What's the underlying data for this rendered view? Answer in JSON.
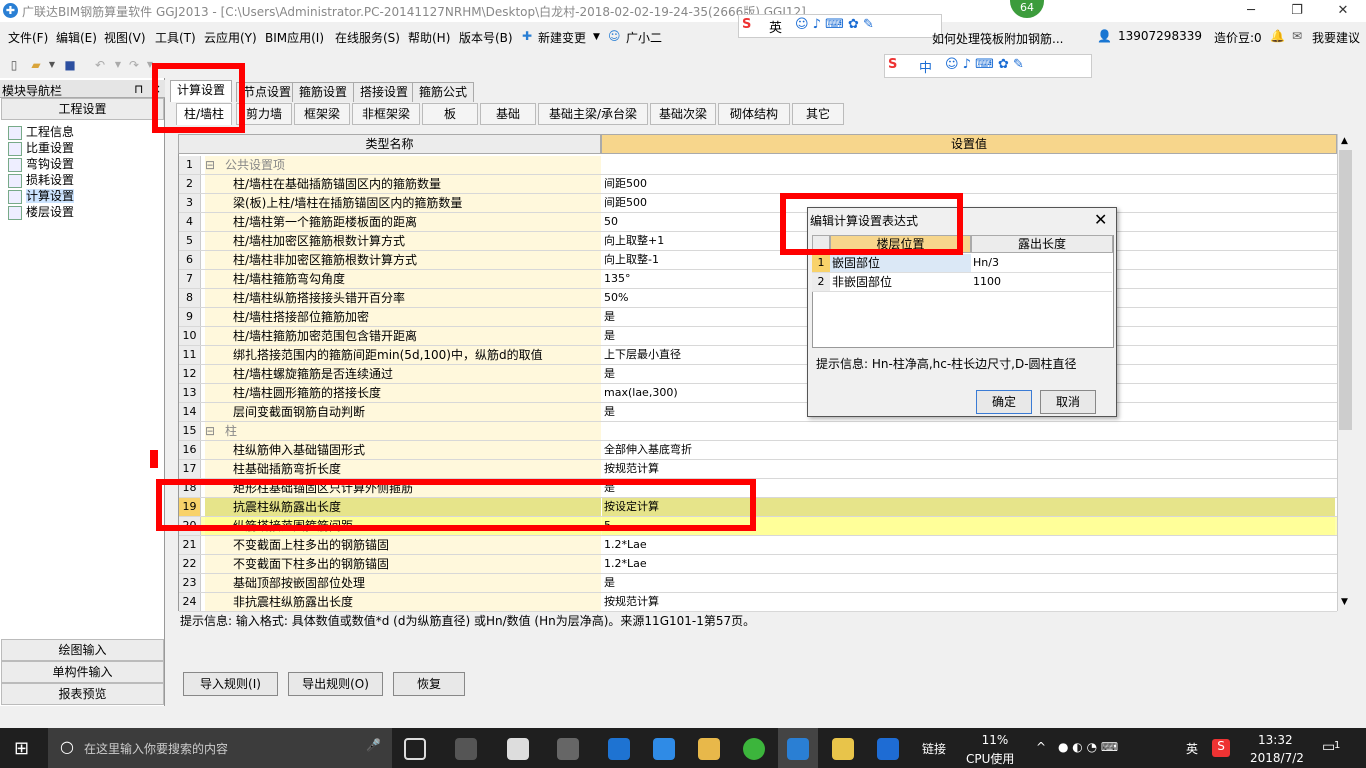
{
  "window": {
    "title": "广联达BIM钢筋算量软件 GGJ2013 - [C:\\Users\\Administrator.PC-20141127NRHM\\Desktop\\白龙村-2018-02-02-19-24-35(2666版).GGJ12]",
    "badge": "64"
  },
  "menu": [
    "文件(F)",
    "编辑(E)",
    "视图(V)",
    "工具(T)",
    "云应用(Y)",
    "BIM应用(I)",
    "在线服务(S)",
    "帮助(H)",
    "版本号(B)",
    "新建变更",
    "广小二"
  ],
  "topright": {
    "promo": "如何处理筏板附加钢筋...",
    "phone": "13907298339",
    "cost": "造价豆:0",
    "feedback": "我要建议"
  },
  "ime": {
    "lang1": "英",
    "lang2": "中"
  },
  "nav": {
    "header": "模块导航栏",
    "section": "工程设置",
    "items": [
      "工程信息",
      "比重设置",
      "弯钩设置",
      "损耗设置",
      "计算设置",
      "楼层设置"
    ],
    "bottom": [
      "绘图输入",
      "单构件输入",
      "报表预览"
    ]
  },
  "tabs1": [
    "计算设置",
    "节点设置",
    "箍筋设置",
    "搭接设置",
    "箍筋公式"
  ],
  "tabs2": [
    "柱/墙柱",
    "剪力墙",
    "框架梁",
    "非框架梁",
    "板",
    "基础",
    "基础主梁/承台梁",
    "基础次梁",
    "砌体结构",
    "其它"
  ],
  "grid": {
    "col1": "类型名称",
    "col2": "设置值",
    "rows": [
      {
        "n": "1",
        "name": "公共设置项",
        "val": "",
        "grp": true
      },
      {
        "n": "2",
        "name": "柱/墙柱在基础插筋锚固区内的箍筋数量",
        "val": "间距500"
      },
      {
        "n": "3",
        "name": "梁(板)上柱/墙柱在插筋锚固区内的箍筋数量",
        "val": "间距500"
      },
      {
        "n": "4",
        "name": "柱/墙柱第一个箍筋距楼板面的距离",
        "val": "50"
      },
      {
        "n": "5",
        "name": "柱/墙柱加密区箍筋根数计算方式",
        "val": "向上取整+1"
      },
      {
        "n": "6",
        "name": "柱/墙柱非加密区箍筋根数计算方式",
        "val": "向上取整-1"
      },
      {
        "n": "7",
        "name": "柱/墙柱箍筋弯勾角度",
        "val": "135°"
      },
      {
        "n": "8",
        "name": "柱/墙柱纵筋搭接接头错开百分率",
        "val": "50%"
      },
      {
        "n": "9",
        "name": "柱/墙柱搭接部位箍筋加密",
        "val": "是"
      },
      {
        "n": "10",
        "name": "柱/墙柱箍筋加密范围包含错开距离",
        "val": "是"
      },
      {
        "n": "11",
        "name": "绑扎搭接范围内的箍筋间距min(5d,100)中，纵筋d的取值",
        "val": "上下层最小直径"
      },
      {
        "n": "12",
        "name": "柱/墙柱螺旋箍筋是否连续通过",
        "val": "是"
      },
      {
        "n": "13",
        "name": "柱/墙柱圆形箍筋的搭接长度",
        "val": "max(lae,300)"
      },
      {
        "n": "14",
        "name": "层间变截面钢筋自动判断",
        "val": "是"
      },
      {
        "n": "15",
        "name": "柱",
        "val": "",
        "grp": true
      },
      {
        "n": "16",
        "name": "柱纵筋伸入基础锚固形式",
        "val": "全部伸入基底弯折"
      },
      {
        "n": "17",
        "name": "柱基础插筋弯折长度",
        "val": "按规范计算"
      },
      {
        "n": "18",
        "name": "矩形柱基础锚固区只计算外侧箍筋",
        "val": "是"
      },
      {
        "n": "19",
        "name": "抗震柱纵筋露出长度",
        "val": "按设定计算",
        "hl": true
      },
      {
        "n": "20",
        "name": "纵筋搭接范围箍筋间距",
        "val": "5",
        "yl": true
      },
      {
        "n": "21",
        "name": "不变截面上柱多出的钢筋锚固",
        "val": "1.2*Lae"
      },
      {
        "n": "22",
        "name": "不变截面下柱多出的钢筋锚固",
        "val": "1.2*Lae"
      },
      {
        "n": "23",
        "name": "基础顶部按嵌固部位处理",
        "val": "是"
      },
      {
        "n": "24",
        "name": "非抗震柱纵筋露出长度",
        "val": "按规范计算"
      }
    ]
  },
  "hint": "提示信息: 输入格式: 具体数值或数值*d (d为纵筋直径) 或Hn/数值 (Hn为层净高)。来源11G101-1第57页。",
  "buttons": {
    "import": "导入规则(I)",
    "export": "导出规则(O)",
    "restore": "恢复"
  },
  "dialog": {
    "title": "编辑计算设置表达式",
    "col1": "楼层位置",
    "col2": "露出长度",
    "rows": [
      {
        "n": "1",
        "pos": "嵌固部位",
        "len": "Hn/3"
      },
      {
        "n": "2",
        "pos": "非嵌固部位",
        "len": "1100"
      }
    ],
    "hint": "提示信息: Hn-柱净高,hc-柱长边尺寸,D-圆柱直径",
    "ok": "确定",
    "cancel": "取消"
  },
  "taskbar": {
    "search": "在这里输入你要搜索的内容",
    "link": "链接",
    "cpu_pct": "11%",
    "cpu_label": "CPU使用",
    "lang": "英",
    "time": "13:32",
    "date": "2018/7/2",
    "notif": "1"
  }
}
